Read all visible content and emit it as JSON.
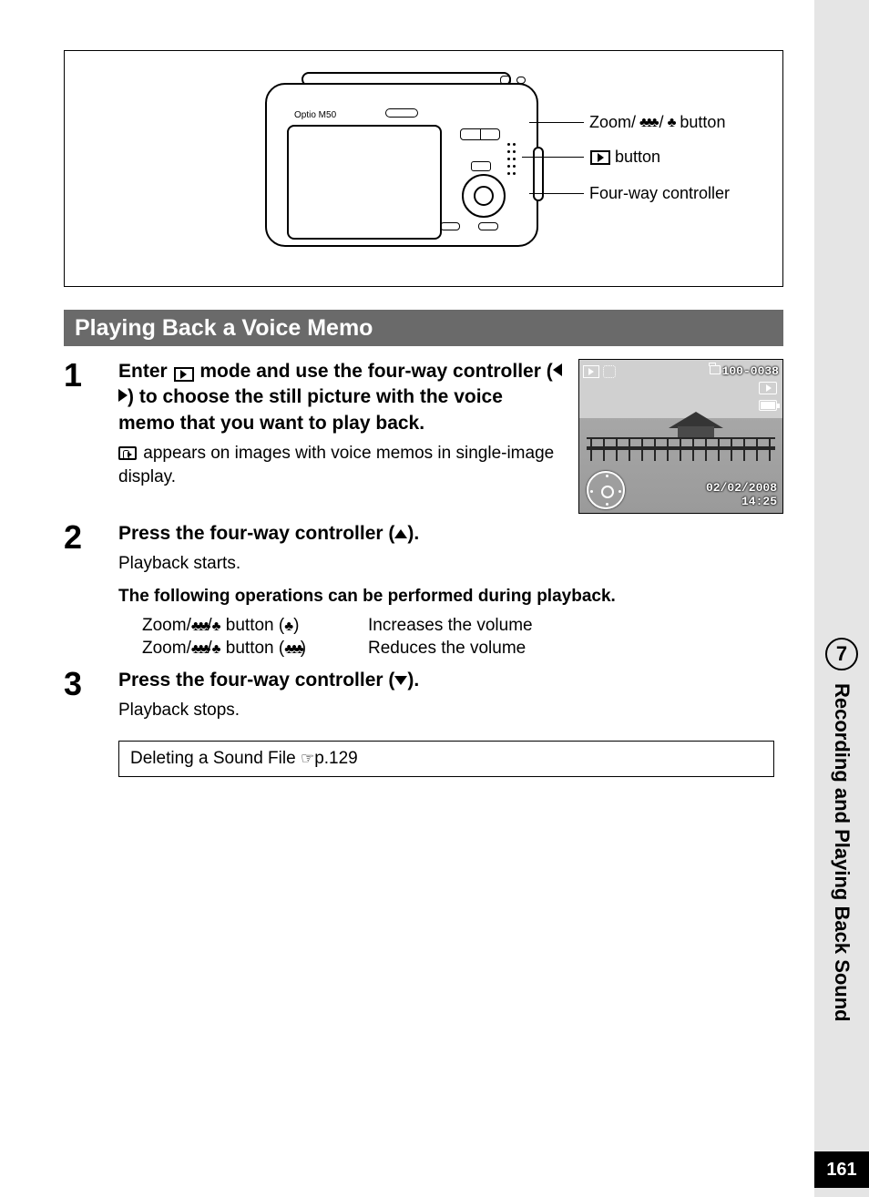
{
  "page_number": "161",
  "chapter_number": "7",
  "chapter_title": "Recording and Playing Back Sound",
  "camera_model": "Optio M50",
  "diagram": {
    "label_zoom": "Zoom/",
    "label_zoom_suffix": " button",
    "label_play_suffix": " button",
    "label_controller": "Four-way controller"
  },
  "section_title": "Playing Back a Voice Memo",
  "step1": {
    "num": "1",
    "bold_a": "Enter ",
    "bold_b": " mode and use the four-way controller (",
    "bold_c": ") to choose the still picture with the voice memo that you want to play back.",
    "desc_a": " appears on images with voice memos in single-image display."
  },
  "screenshot": {
    "folder_file": "100-0038",
    "date": "02/02/2008",
    "time": "14:25"
  },
  "step2": {
    "num": "2",
    "bold_a": "Press the four-way controller (",
    "bold_b": ").",
    "desc": "Playback starts.",
    "ops_title": "The following operations can be performed during playback.",
    "op1_k_a": "Zoom/",
    "op1_k_b": " button (",
    "op1_k_c": ")",
    "op1_v": "Increases the volume",
    "op2_k_a": "Zoom/",
    "op2_k_b": " button (",
    "op2_k_c": ")",
    "op2_v": "Reduces the volume"
  },
  "step3": {
    "num": "3",
    "bold_a": "Press the four-way controller (",
    "bold_b": ").",
    "desc": "Playback stops."
  },
  "xref": {
    "text": "Deleting a Sound File ",
    "page": "p.129"
  }
}
